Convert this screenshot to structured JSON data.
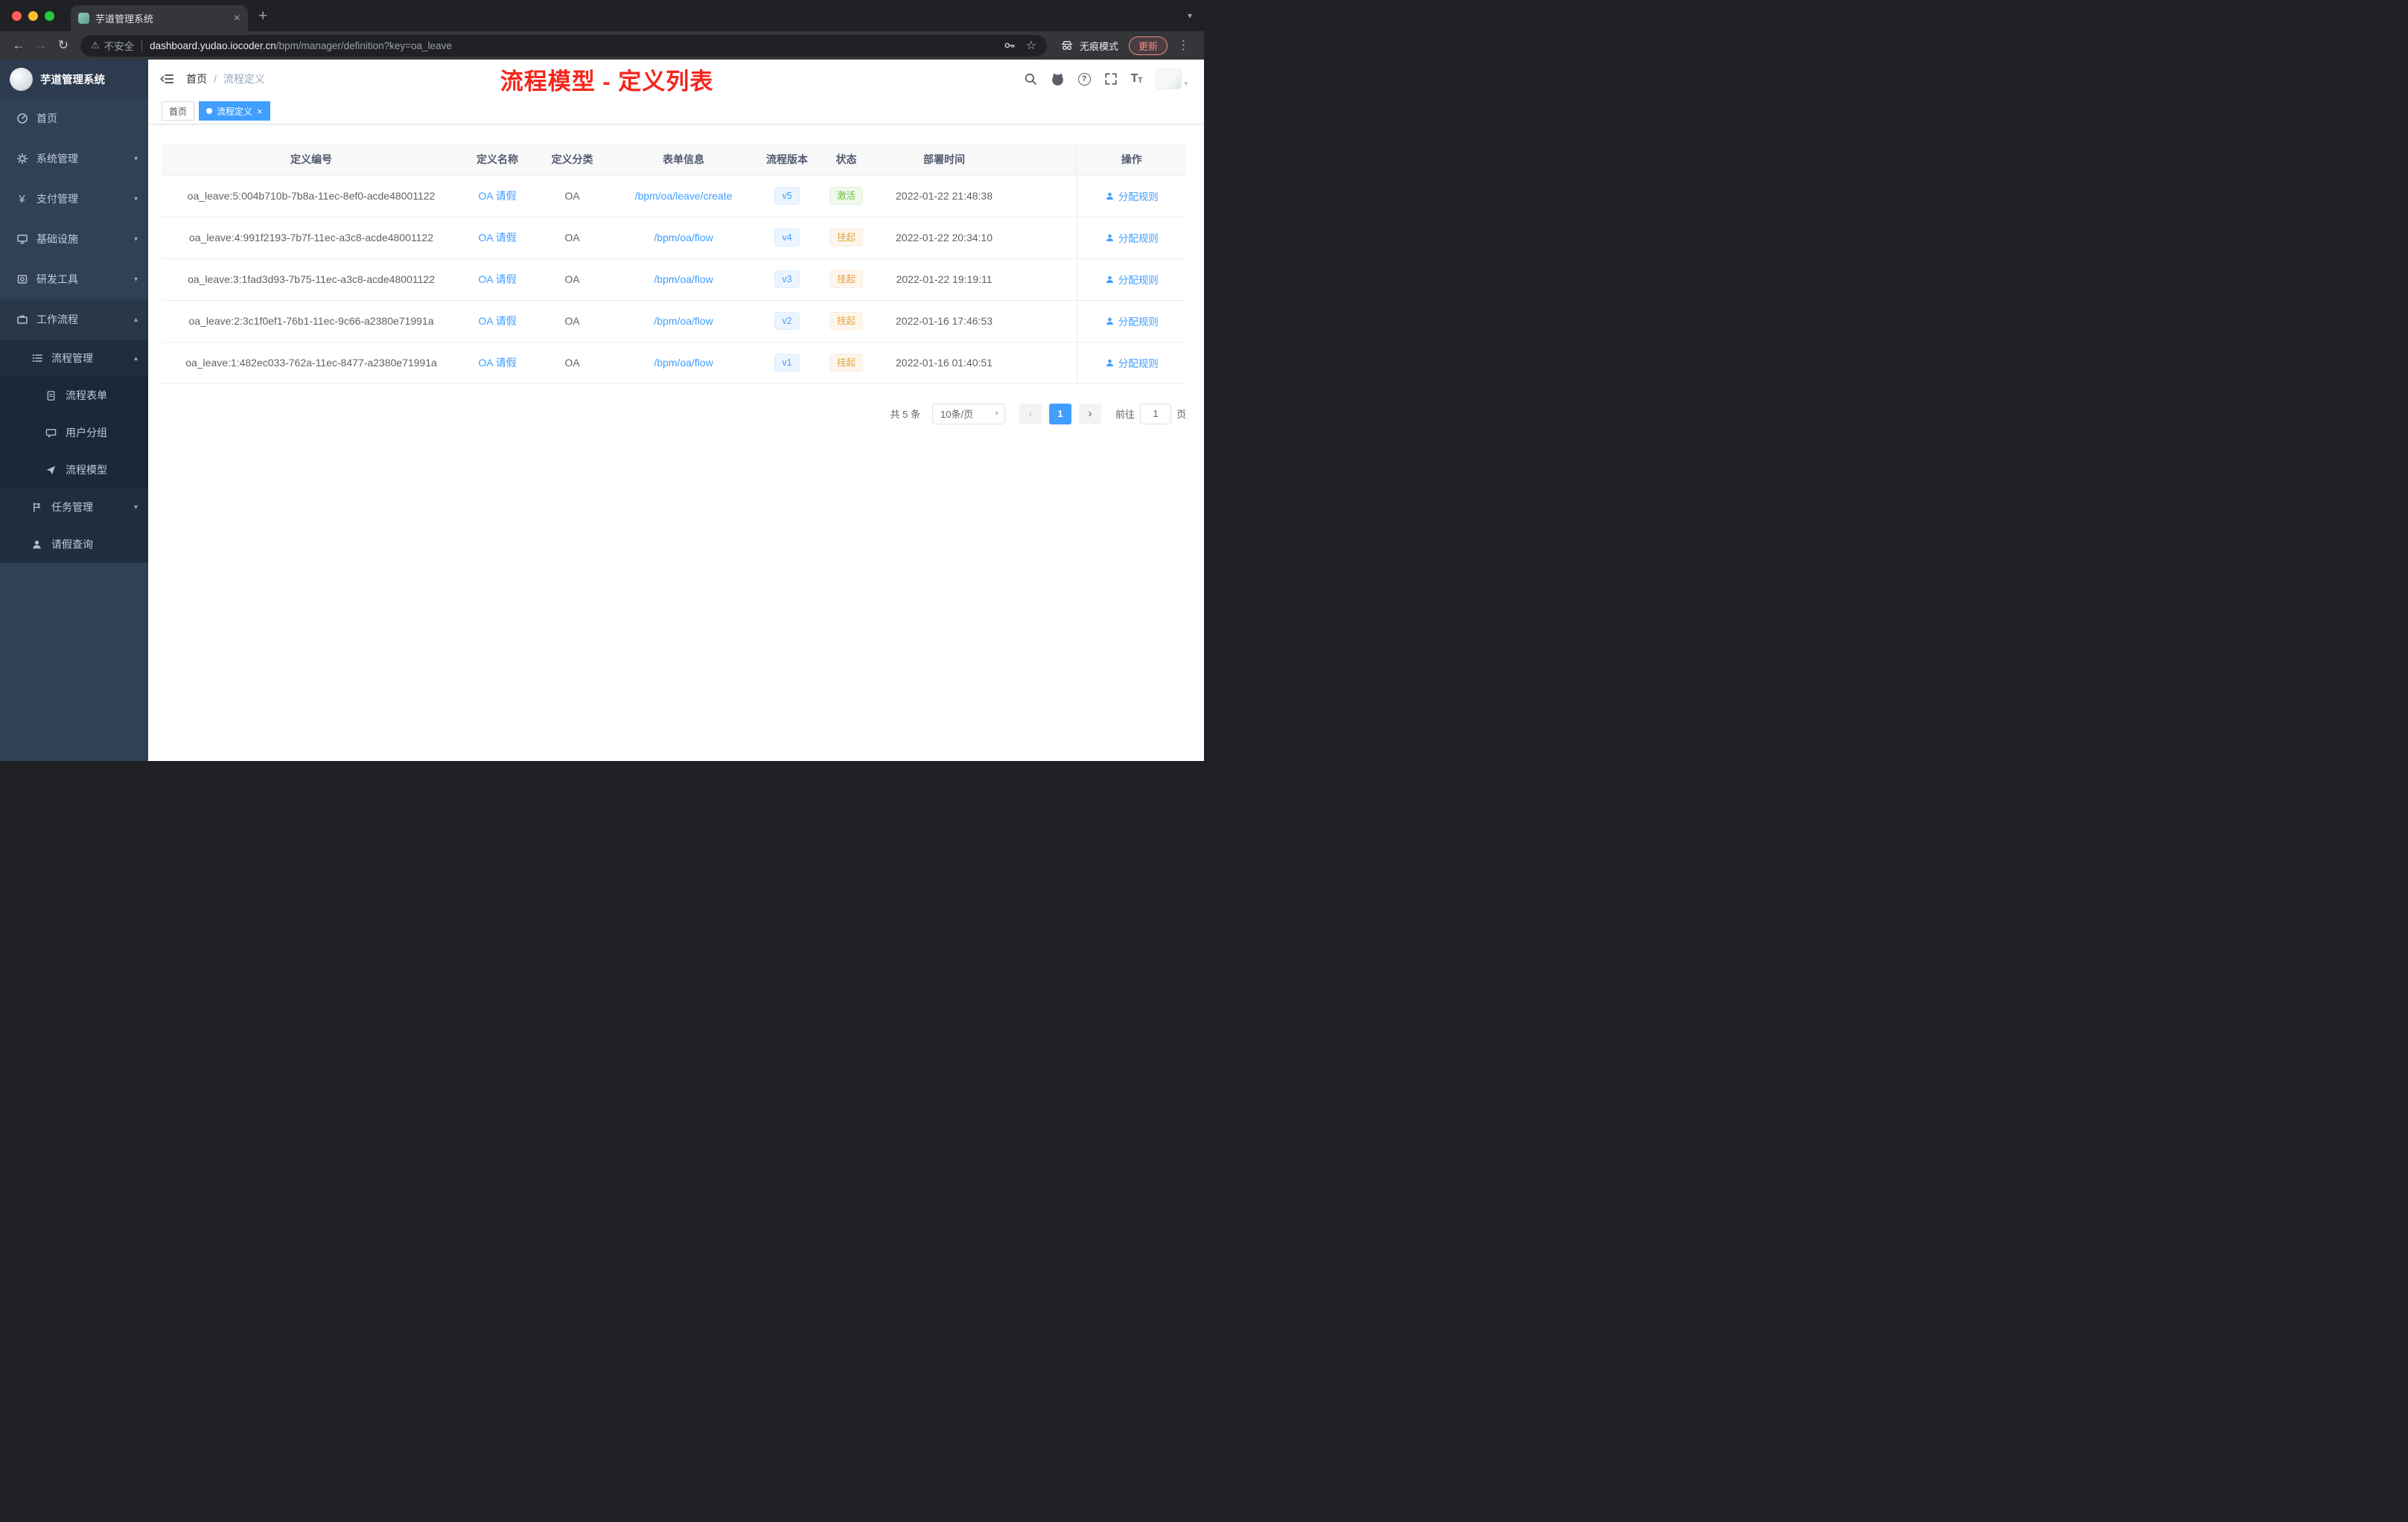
{
  "colors": {
    "accent": "#409eff",
    "annotation_red": "#f5261d",
    "active_green": "#67c23a",
    "suspend_orange": "#e6a23c",
    "sidebar_bg": "#304156"
  },
  "icons": {
    "close": "×",
    "new_tab": "+",
    "window_chevron": "▾",
    "back": "←",
    "forward": "→",
    "reload": "↻",
    "warning": "⚠",
    "star": "☆",
    "menu_dots": "⋮",
    "chevron_down": "▾",
    "chevron_up": "▴",
    "yen": "¥",
    "prev": "‹",
    "next": "›",
    "question": "?",
    "select_chevron": "▾",
    "avatar_caret": "▾",
    "font_big": "T",
    "font_small": "T"
  },
  "browser": {
    "tab_title": "芋道管理系统",
    "security_label": "不安全",
    "url_host": "dashboard.yudao.iocoder.cn",
    "url_path": "/bpm/manager/definition?key=oa_leave",
    "incognito_label": "无痕模式",
    "update_label": "更新"
  },
  "sidebar": {
    "logo_title": "芋道管理系统",
    "items": [
      {
        "label": "首页"
      },
      {
        "label": "系统管理"
      },
      {
        "label": "支付管理"
      },
      {
        "label": "基础设施"
      },
      {
        "label": "研发工具"
      },
      {
        "label": "工作流程"
      },
      {
        "label": "流程管理"
      },
      {
        "label": "流程表单"
      },
      {
        "label": "用户分组"
      },
      {
        "label": "流程模型"
      },
      {
        "label": "任务管理"
      },
      {
        "label": "请假查询"
      }
    ]
  },
  "header": {
    "breadcrumb_home": "首页",
    "breadcrumb_sep": "/",
    "breadcrumb_current": "流程定义",
    "annotation": "流程模型 - 定义列表"
  },
  "tags": {
    "home": "首页",
    "active": "流程定义"
  },
  "table": {
    "columns": [
      "定义编号",
      "定义名称",
      "定义分类",
      "表单信息",
      "流程版本",
      "状态",
      "部署时间",
      "操作"
    ],
    "rows": [
      {
        "id": "oa_leave:5:004b710b-7b8a-11ec-8ef0-acde48001122",
        "name": "OA 请假",
        "category": "OA",
        "form": "/bpm/oa/leave/create",
        "version": "v5",
        "status": "激活",
        "time": "2022-01-22 21:48:38",
        "action": "分配规则"
      },
      {
        "id": "oa_leave:4:991f2193-7b7f-11ec-a3c8-acde48001122",
        "name": "OA 请假",
        "category": "OA",
        "form": "/bpm/oa/flow",
        "version": "v4",
        "status": "挂起",
        "time": "2022-01-22 20:34:10",
        "action": "分配规则"
      },
      {
        "id": "oa_leave:3:1fad3d93-7b75-11ec-a3c8-acde48001122",
        "name": "OA 请假",
        "category": "OA",
        "form": "/bpm/oa/flow",
        "version": "v3",
        "status": "挂起",
        "time": "2022-01-22 19:19:11",
        "action": "分配规则"
      },
      {
        "id": "oa_leave:2:3c1f0ef1-76b1-11ec-9c66-a2380e71991a",
        "name": "OA 请假",
        "category": "OA",
        "form": "/bpm/oa/flow",
        "version": "v2",
        "status": "挂起",
        "time": "2022-01-16 17:46:53",
        "action": "分配规则"
      },
      {
        "id": "oa_leave:1:482ec033-762a-11ec-8477-a2380e71991a",
        "name": "OA 请假",
        "category": "OA",
        "form": "/bpm/oa/flow",
        "version": "v1",
        "status": "挂起",
        "time": "2022-01-16 01:40:51",
        "action": "分配规则"
      }
    ]
  },
  "pagination": {
    "total": "共 5 条",
    "page_size": "10条/页",
    "current_page": "1",
    "goto_label": "前往",
    "goto_value": "1",
    "page_unit": "页"
  }
}
